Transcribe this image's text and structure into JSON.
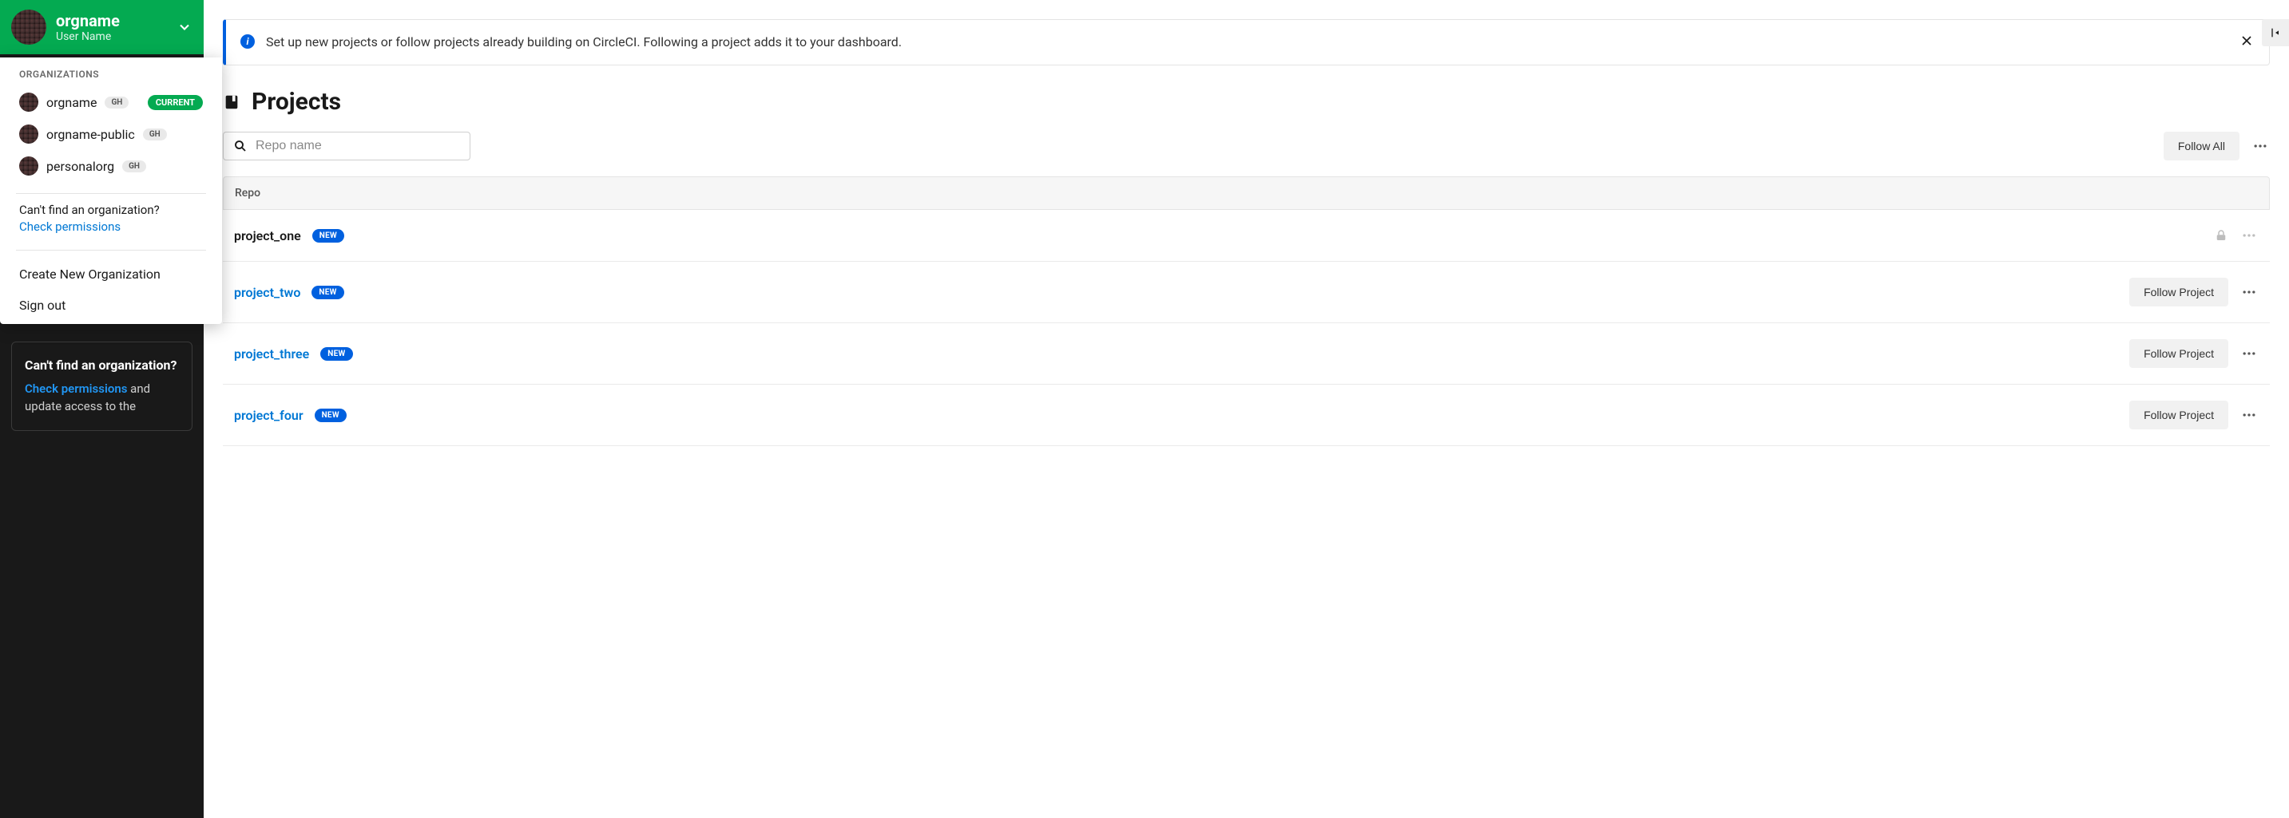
{
  "sidebar": {
    "org_name": "orgname",
    "user_name": "User Name"
  },
  "org_dropdown": {
    "heading": "ORGANIZATIONS",
    "items": [
      {
        "name": "orgname",
        "provider": "GH",
        "is_current": true
      },
      {
        "name": "orgname-public",
        "provider": "GH",
        "is_current": false
      },
      {
        "name": "personalorg",
        "provider": "GH",
        "is_current": false
      }
    ],
    "current_label": "CURRENT",
    "cant_find_text": "Can't find an organization?",
    "check_permissions_label": "Check permissions",
    "create_org_label": "Create New Organization",
    "sign_out_label": "Sign out"
  },
  "sidebar_card": {
    "title": "Can't find an organization?",
    "link_label": "Check permissions",
    "body_suffix": " and update access to the"
  },
  "banner": {
    "text": "Set up new projects or follow projects already building on CircleCI. Following a project adds it to your dashboard."
  },
  "page": {
    "title": "Projects",
    "search_placeholder": "Repo name",
    "follow_all_label": "Follow All",
    "table_header": "Repo"
  },
  "projects": [
    {
      "name": "project_one",
      "is_link": false,
      "badge": "NEW",
      "locked": true,
      "follow_label": null
    },
    {
      "name": "project_two",
      "is_link": true,
      "badge": "NEW",
      "locked": false,
      "follow_label": "Follow Project"
    },
    {
      "name": "project_three",
      "is_link": true,
      "badge": "NEW",
      "locked": false,
      "follow_label": "Follow Project"
    },
    {
      "name": "project_four",
      "is_link": true,
      "badge": "NEW",
      "locked": false,
      "follow_label": "Follow Project"
    }
  ]
}
